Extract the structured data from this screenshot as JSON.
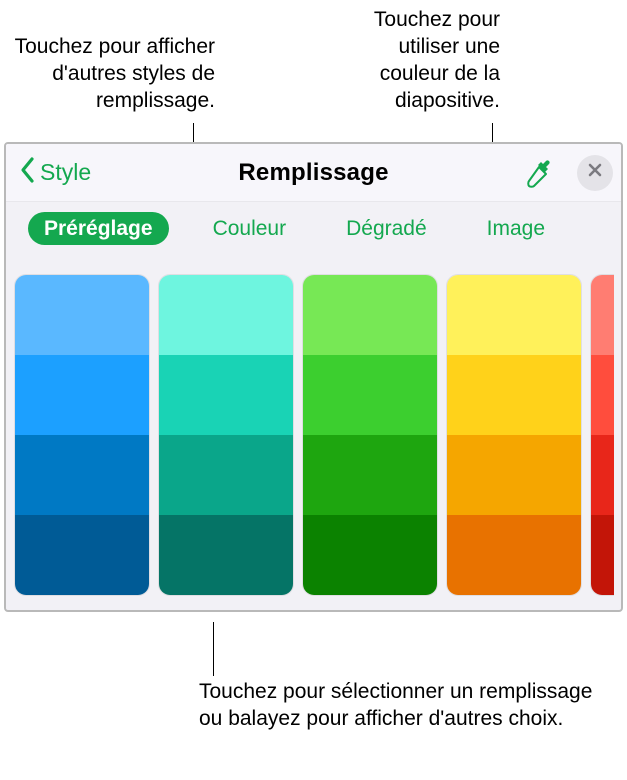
{
  "callouts": {
    "top_left": "Touchez pour afficher d'autres styles de remplissage.",
    "top_right": "Touchez pour utiliser une couleur de la diapositive.",
    "bottom": "Touchez pour sélectionner un remplissage ou balayez pour afficher d'autres choix."
  },
  "header": {
    "back_label": "Style",
    "title": "Remplissage"
  },
  "tabs": {
    "preset": "Préréglage",
    "color": "Couleur",
    "gradient": "Dégradé",
    "image": "Image",
    "active": "preset"
  },
  "swatch_columns": [
    {
      "name": "blue",
      "shades": [
        "#5ab8ff",
        "#1ca0ff",
        "#0079c4",
        "#005b96"
      ]
    },
    {
      "name": "teal",
      "shades": [
        "#6ef5df",
        "#19d3b5",
        "#0aa68a",
        "#057466"
      ]
    },
    {
      "name": "green",
      "shades": [
        "#77e855",
        "#3ccf2f",
        "#1ea60f",
        "#0b8200"
      ]
    },
    {
      "name": "yellow",
      "shades": [
        "#fff15a",
        "#ffd21a",
        "#f5a600",
        "#e87200"
      ]
    },
    {
      "name": "red",
      "shades": [
        "#ff7d72",
        "#ff4d3d",
        "#e8261a",
        "#c31508"
      ]
    }
  ],
  "icons": {
    "back": "chevron-left-icon",
    "eyedropper": "eyedropper-icon",
    "close": "close-icon"
  },
  "theme": {
    "accent": "#14a84f"
  }
}
